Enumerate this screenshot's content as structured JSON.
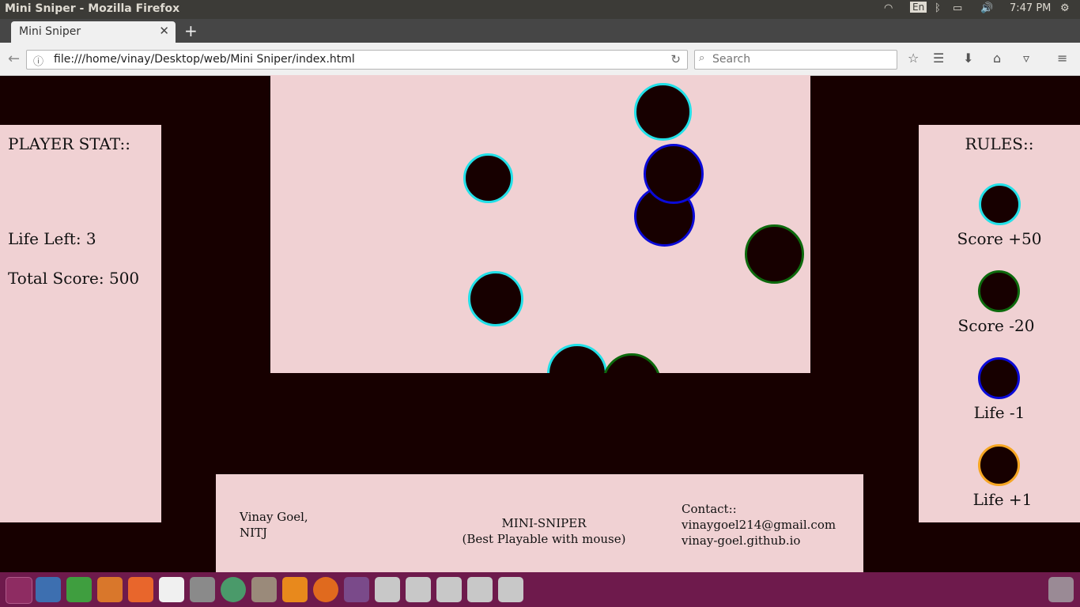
{
  "system": {
    "window_title": "Mini Sniper - Mozilla Firefox",
    "keyboard": "En",
    "clock": "7:47 PM"
  },
  "browser": {
    "tab_title": "Mini Sniper",
    "url": "file:///home/vinay/Desktop/web/Mini Sniper/index.html",
    "search_placeholder": "Search"
  },
  "player": {
    "heading": "PLAYER STAT::",
    "life": "Life Left: 3",
    "score": "Total Score: 500"
  },
  "rules": {
    "heading": "RULES::",
    "items": [
      {
        "label": "Score +50",
        "ring": "#22e0e8"
      },
      {
        "label": "Score -20",
        "ring": "#0d6a0d"
      },
      {
        "label": "Life -1",
        "ring": "#0a0ad8"
      },
      {
        "label": "Life +1",
        "ring": "#f5a623"
      }
    ]
  },
  "arena": {
    "background": "#f0d1d3",
    "targets": [
      {
        "type": "cyan"
      },
      {
        "type": "cyan"
      },
      {
        "type": "blue"
      },
      {
        "type": "blue"
      },
      {
        "type": "green"
      },
      {
        "type": "cyan"
      },
      {
        "type": "cyan"
      },
      {
        "type": "green"
      }
    ]
  },
  "footer": {
    "author": "Vinay Goel,",
    "org": "NITJ",
    "game_name": "MINI-SNIPER",
    "tagline": "(Best Playable with mouse)",
    "contact_heading": "Contact::",
    "email": "vinaygoel214@gmail.com",
    "site": "vinay-goel.github.io"
  },
  "colors": {
    "page_bg": "#170000",
    "panel_bg": "#f0d1d3",
    "dock_bg": "#6e1a4c"
  }
}
